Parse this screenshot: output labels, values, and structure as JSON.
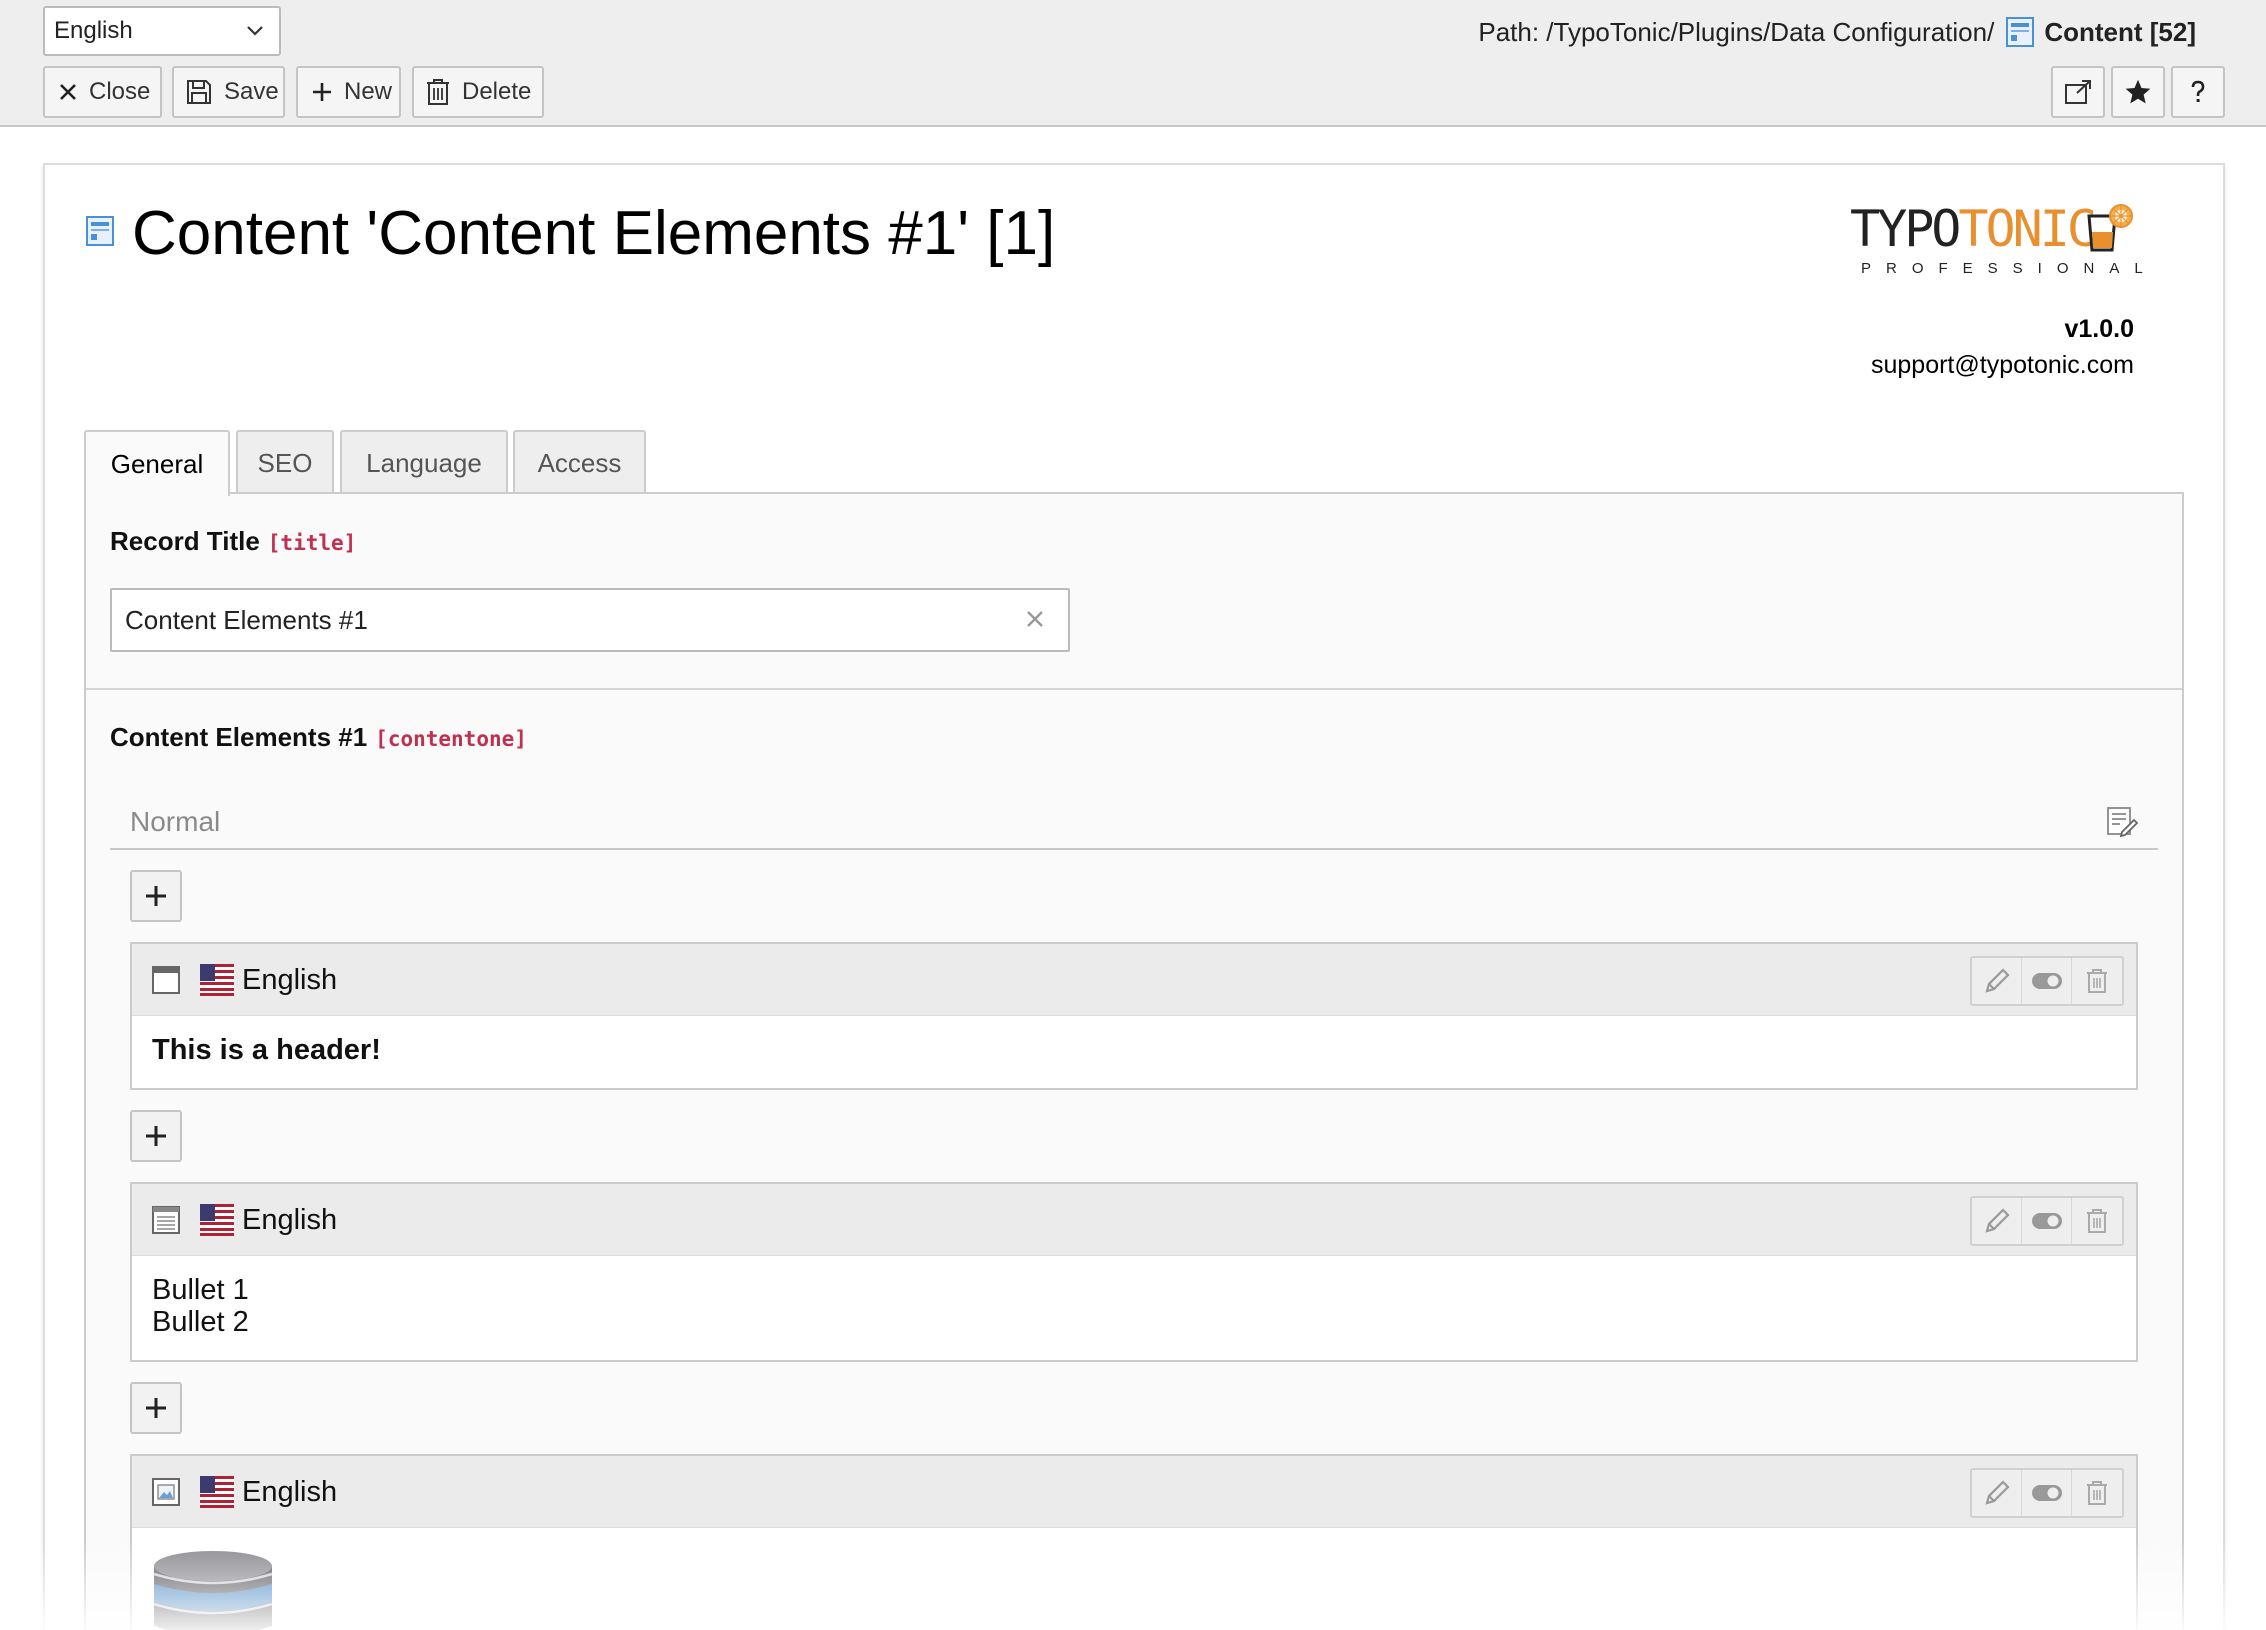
{
  "toolbar": {
    "language_select": {
      "value": "English"
    },
    "path_label": "Path: /TypoTonic/Plugins/Data Configuration/",
    "record_label": "Content [52]",
    "buttons": {
      "close": "Close",
      "save": "Save",
      "new": "New",
      "delete": "Delete"
    }
  },
  "header": {
    "title": "Content 'Content Elements #1' [1]",
    "logo": {
      "main_dark": "TYPO",
      "main_orange": "TONIC",
      "sub": "PROFESSIONAL"
    },
    "version": "v1.0.0",
    "support_email": "support@typotonic.com"
  },
  "tabs": [
    {
      "label": "General",
      "active": true
    },
    {
      "label": "SEO",
      "active": false
    },
    {
      "label": "Language",
      "active": false
    },
    {
      "label": "Access",
      "active": false
    }
  ],
  "fields": {
    "record_title": {
      "label": "Record Title",
      "key": "[title]",
      "value": "Content Elements #1"
    },
    "content_elements": {
      "label": "Content Elements #1",
      "key": "[contentone]",
      "column_label": "Normal",
      "items": [
        {
          "type_icon": "header-type-icon",
          "language": "English",
          "body": "This is a header!"
        },
        {
          "type_icon": "bullets-type-icon",
          "language": "English",
          "lines": [
            "Bullet 1",
            "Bullet 2"
          ]
        },
        {
          "type_icon": "image-type-icon",
          "language": "English"
        }
      ]
    }
  },
  "colors": {
    "accent_orange": "#e8902f",
    "field_key_red": "#c0304f",
    "record_icon_blue": "#4a90d9"
  }
}
